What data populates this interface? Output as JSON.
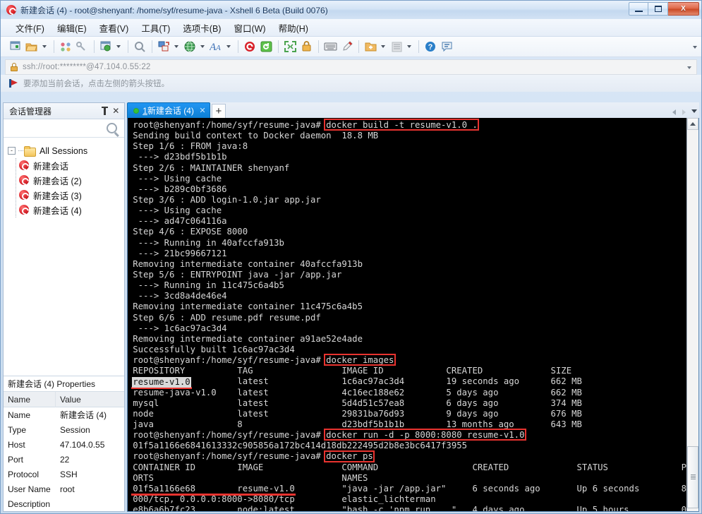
{
  "window": {
    "title": "新建会话 (4) - root@shenyanf: /home/syf/resume-java - Xshell 6 Beta (Build 0076)",
    "app_icon": "xshell-icon",
    "minimize_label": "",
    "maximize_label": "",
    "close_label": "X"
  },
  "menubar": {
    "items": [
      {
        "label": "文件(F)",
        "name": "menu-file"
      },
      {
        "label": "编辑(E)",
        "name": "menu-edit"
      },
      {
        "label": "查看(V)",
        "name": "menu-view"
      },
      {
        "label": "工具(T)",
        "name": "menu-tools"
      },
      {
        "label": "选项卡(B)",
        "name": "menu-tabs"
      },
      {
        "label": "窗口(W)",
        "name": "menu-window"
      },
      {
        "label": "帮助(H)",
        "name": "menu-help"
      }
    ]
  },
  "toolbar": {
    "icons": [
      "new-session-icon",
      "open-folder-icon",
      "sessions-icon",
      "link-icon",
      "properties-icon",
      "find-icon",
      "transfer-icon",
      "globe-icon",
      "font-icon",
      "xshell-icon",
      "reconnect-icon",
      "fullscreen-icon",
      "lock-icon",
      "keyboard-icon",
      "highlight-icon",
      "add-note-icon",
      "list-icon",
      "help-icon",
      "chat-icon"
    ],
    "overflow": "toolbar-overflow-chevron"
  },
  "address_bar": {
    "value": "ssh://root:********@47.104.0.55:22",
    "lock_icon": "lock-icon",
    "dropdown_icon": "chevron-down-icon"
  },
  "hint_bar": {
    "text": "要添加当前会话，点击左侧的箭头按钮。",
    "icon": "red-arrow-flag-icon"
  },
  "session_manager": {
    "title": "会话管理器",
    "pin_icon": "pin-icon",
    "close_icon": "close-icon",
    "search_icon": "search-icon",
    "search_placeholder": "",
    "tree": {
      "root_label": "All Sessions",
      "root_expander": "-",
      "root_icon": "folder-icon",
      "children": [
        {
          "label": "新建会话",
          "icon": "session-icon"
        },
        {
          "label": "新建会话 (2)",
          "icon": "session-icon"
        },
        {
          "label": "新建会话 (3)",
          "icon": "session-icon"
        },
        {
          "label": "新建会话 (4)",
          "icon": "session-icon"
        }
      ]
    },
    "properties_title": "新建会话 (4) Properties",
    "properties_headers": {
      "name": "Name",
      "value": "Value"
    },
    "properties_rows": [
      {
        "name": "Name",
        "value": "新建会话 (4)"
      },
      {
        "name": "Type",
        "value": "Session"
      },
      {
        "name": "Host",
        "value": "47.104.0.55"
      },
      {
        "name": "Port",
        "value": "22"
      },
      {
        "name": "Protocol",
        "value": "SSH"
      },
      {
        "name": "User Name",
        "value": "root"
      },
      {
        "name": "Description",
        "value": ""
      }
    ]
  },
  "tabs": {
    "active": {
      "index": "1",
      "label": "新建会话 (4)",
      "status_dot_color": "#35c23a",
      "close_icon": "close-icon"
    },
    "new_tab_label": "+",
    "nav_prev_icon": "chevron-left-icon",
    "nav_next_icon": "chevron-right-icon",
    "nav_list_icon": "chevron-down-icon"
  },
  "terminal": {
    "prompt": "root@shenyanf:/home/syf/resume-java#",
    "lines": [
      "root@shenyanf:/home/syf/resume-java# docker build -t resume-v1.0 .",
      "Sending build context to Docker daemon  18.8 MB",
      "Step 1/6 : FROM java:8",
      " ---> d23bdf5b1b1b",
      "Step 2/6 : MAINTAINER shenyanf",
      " ---> Using cache",
      " ---> b289c0bf3686",
      "Step 3/6 : ADD login-1.0.jar app.jar",
      " ---> Using cache",
      " ---> ad47c064116a",
      "Step 4/6 : EXPOSE 8000",
      " ---> Running in 40afccfa913b",
      " ---> 21bc99667121",
      "Removing intermediate container 40afccfa913b",
      "Step 5/6 : ENTRYPOINT java -jar /app.jar",
      " ---> Running in 11c475c6a4b5",
      " ---> 3cd8a4de46e4",
      "Removing intermediate container 11c475c6a4b5",
      "Step 6/6 : ADD resume.pdf resume.pdf",
      " ---> 1c6ac97ac3d4",
      "Removing intermediate container a91ae52e4ade",
      "Successfully built 1c6ac97ac3d4",
      "root@shenyanf:/home/syf/resume-java# docker images",
      "REPOSITORY          TAG                 IMAGE ID            CREATED             SIZE",
      "resume-v1.0         latest              1c6ac97ac3d4        19 seconds ago      662 MB",
      "resume-java-v1.0    latest              4c16ec188e62        5 days ago          662 MB",
      "mysql               latest              5d4d51c57ea8        6 days ago          374 MB",
      "node                latest              29831ba76d93        9 days ago          676 MB",
      "java                8                   d23bdf5b1b1b        13 months ago       643 MB",
      "root@shenyanf:/home/syf/resume-java# docker run -d -p 8000:8080 resume-v1.0",
      "01f5a1166e6841613332c905856a172bc414d18db222495d2b8e3bc6417f3955",
      "root@shenyanf:/home/syf/resume-java# docker ps",
      "CONTAINER ID        IMAGE               COMMAND                  CREATED             STATUS              P",
      "ORTS                                    NAMES",
      "01f5a1166e68        resume-v1.0         \"java -jar /app.jar\"     6 seconds ago       Up 6 seconds        8",
      "000/tcp, 0.0.0.0:8000->8080/tcp         elastic_lichterman",
      "e8b6a6b7fc23        node:latest         \"bash -c 'npm run ...\"   4 days ago          Up 5 hours          0"
    ],
    "highlight_color": "#e8332f",
    "annotations": [
      {
        "type": "box",
        "text": "docker build -t resume-v1.0 .",
        "line": 0
      },
      {
        "type": "box",
        "text": "docker images",
        "line": 22
      },
      {
        "type": "underline",
        "text": "resume-v1.0",
        "line": 24
      },
      {
        "type": "box",
        "text": "docker run -d -p 8000:8080 resume-v1.0",
        "line": 29
      },
      {
        "type": "box",
        "text": "docker ps",
        "line": 31
      },
      {
        "type": "underline",
        "text": "01f5a1166e68        resume-v1.0",
        "line": 34
      }
    ],
    "scrollbar": {
      "up_icon": "scroll-up-arrow",
      "down_icon": "scroll-down-arrow",
      "thumb_position": "bottom"
    }
  }
}
